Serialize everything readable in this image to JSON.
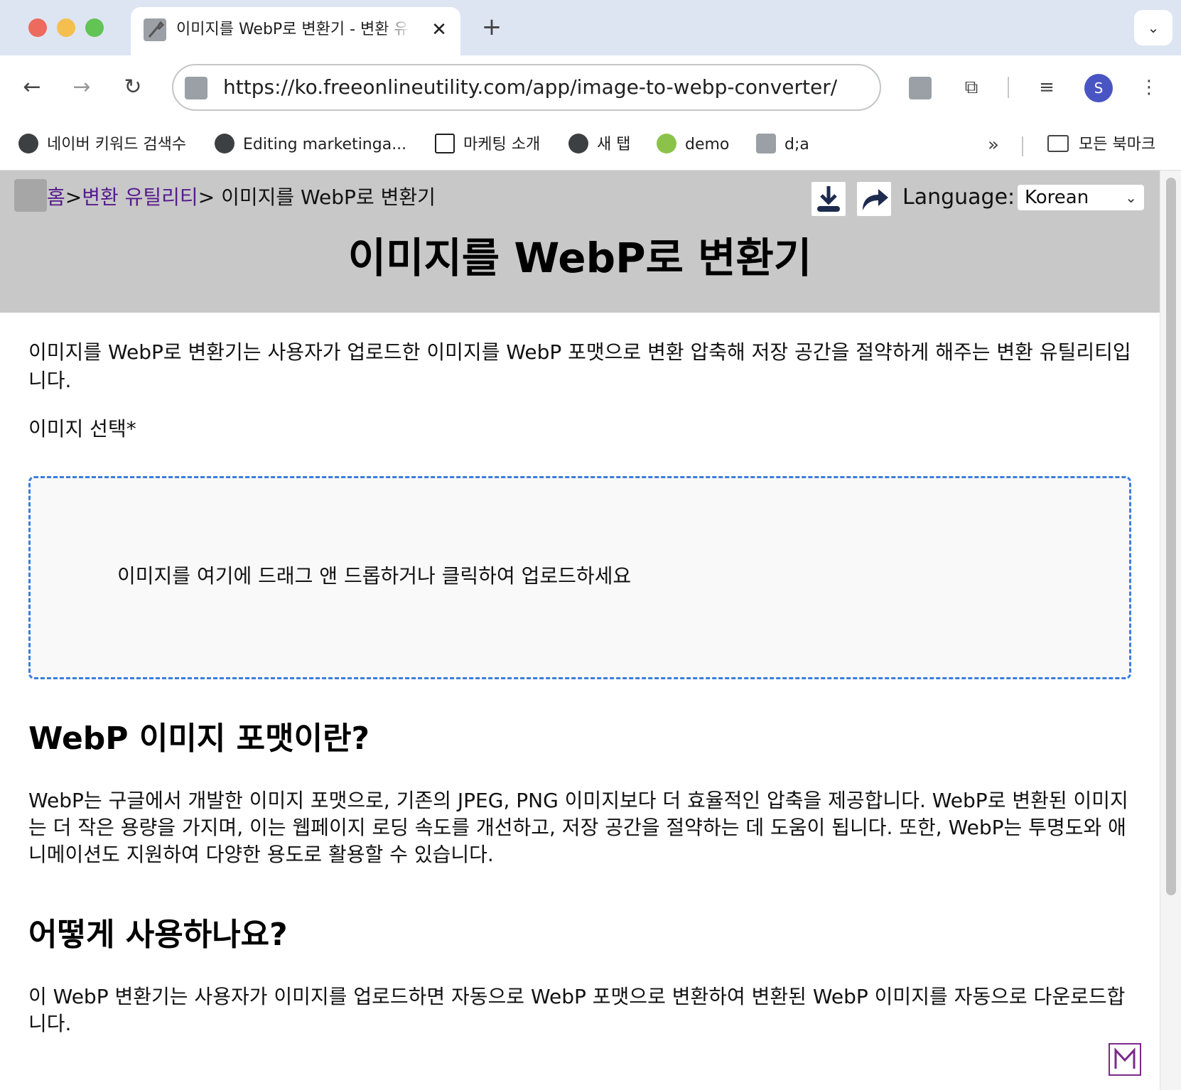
{
  "browser": {
    "tab_title": "이미지를 WebP로 변환기 - 변환 유틸리티",
    "tab_close": "✕",
    "new_tab": "+",
    "url": "https://ko.freeonlineutility.com/app/image-to-webp-converter/",
    "avatar_letter": "S",
    "bookmarks": [
      {
        "label": "네이버 키워드 검색수"
      },
      {
        "label": "Editing marketinga..."
      },
      {
        "label": "마케팅 소개"
      },
      {
        "label": "새 탭"
      },
      {
        "label": "demo"
      },
      {
        "label": "d;a"
      }
    ],
    "bookmarks_overflow": "»",
    "all_bookmarks": "모든 북마크"
  },
  "page": {
    "breadcrumb": {
      "home": "홈",
      "sep1": ">",
      "category": "변환 유틸리티",
      "sep2": ">",
      "current": " 이미지를 WebP로 변환기"
    },
    "language_label": "Language:",
    "language_value": "Korean",
    "title": "이미지를 WebP로 변환기",
    "intro": "이미지를 WebP로 변환기는 사용자가 업로드한 이미지를 WebP 포맷으로 변환 압축해 저장 공간을 절약하게 해주는 변환 유틸리티입니다.",
    "field_label": "이미지 선택*",
    "dropzone_text": "이미지를 여기에 드래그 앤 드롭하거나 클릭하여 업로드하세요",
    "sections": [
      {
        "heading": "WebP 이미지 포맷이란?",
        "body": "WebP는 구글에서 개발한 이미지 포맷으로, 기존의 JPEG, PNG 이미지보다 더 효율적인 압축을 제공합니다. WebP로 변환된 이미지는 더 작은 용량을 가지며, 이는 웹페이지 로딩 속도를 개선하고, 저장 공간을 절약하는 데 도움이 됩니다. 또한, WebP는 투명도와 애니메이션도 지원하여 다양한 용도로 활용할 수 있습니다."
      },
      {
        "heading": "어떻게 사용하나요?",
        "body": "이 WebP 변환기는 사용자가 이미지를 업로드하면 자동으로 WebP 포맷으로 변환하여 변환된 WebP 이미지를 자동으로 다운로드합니다."
      }
    ]
  },
  "colors": {
    "header_bg": "#c8c8c8",
    "link_visited": "#551a8b",
    "dropzone_border": "#3b7ddd",
    "avatar_bg": "#4a55c4"
  }
}
